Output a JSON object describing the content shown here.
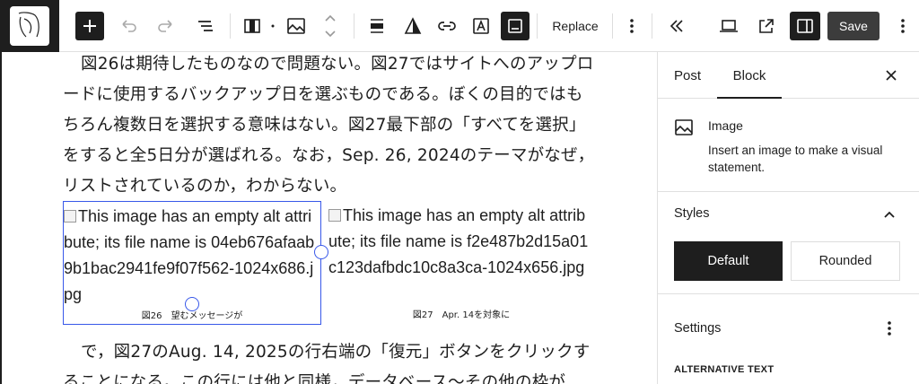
{
  "toolbar": {
    "replace_label": "Replace",
    "save_label": "Save"
  },
  "content": {
    "paragraph1": "図26は期待したものなので問題ない。図27ではサイトへのアップロードに使用するバックアップ日を選ぶものである。ぼくの目的ではもちろん複数日を選択する意味はない。図27最下部の「すべてを選択」をすると全5日分が選ばれる。なお，Sep. 26, 2024のテーマがなぜ，リストされているのか，わからない。",
    "image1_alt": "This image has an empty alt attribute; its file name is 04eb676afaab9b1bac2941fe9f07f562-1024x686.jpg",
    "image1_caption": "図26　望むメッセージが",
    "image2_alt": "This image has an empty alt attribute; its file name is f2e487b2d15a01c123dafbdc10c8a3ca-1024x656.jpg",
    "image2_caption": "図27　Apr. 14を対象に",
    "paragraph2": "で，図27のAug. 14, 2025の行右端の「復元」ボタンをクリックすることになる。この行には他と同様，データベース〜その他の枠が"
  },
  "sidebar": {
    "tab_post": "Post",
    "tab_block": "Block",
    "block_title": "Image",
    "block_desc": "Insert an image to make a visual statement.",
    "styles_title": "Styles",
    "style_default": "Default",
    "style_rounded": "Rounded",
    "settings_title": "Settings",
    "alt_text_label": "ALTERNATIVE TEXT"
  }
}
